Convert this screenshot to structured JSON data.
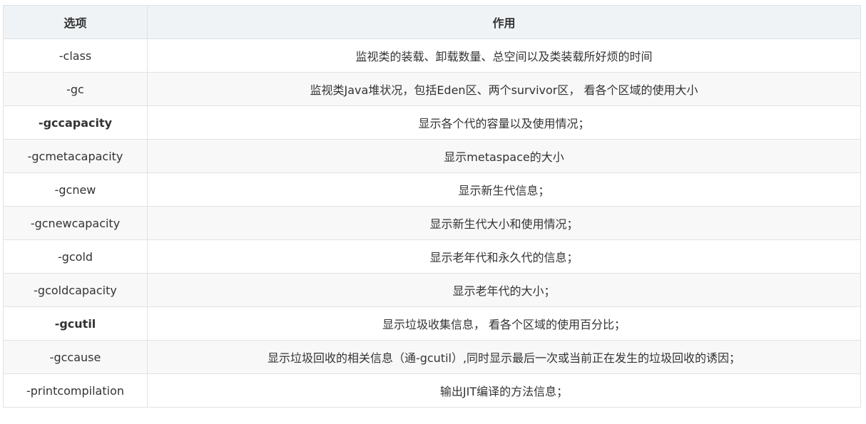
{
  "table": {
    "headers": [
      "选项",
      "作用"
    ],
    "rows": [
      {
        "option": "-class",
        "desc": "监视类的装载、卸载数量、总空间以及类装载所好烦的时间",
        "bold": false
      },
      {
        "option": "-gc",
        "desc": "监视类Java堆状况，包括Eden区、两个survivor区， 看各个区域的使用大小",
        "bold": false
      },
      {
        "option": "-gccapacity",
        "desc": "显示各个代的容量以及使用情况；",
        "bold": true
      },
      {
        "option": "-gcmetacapacity",
        "desc": "显示metaspace的大小",
        "bold": false
      },
      {
        "option": "-gcnew",
        "desc": "显示新生代信息；",
        "bold": false
      },
      {
        "option": "-gcnewcapacity",
        "desc": "显示新生代大小和使用情况；",
        "bold": false
      },
      {
        "option": "-gcold",
        "desc": "显示老年代和永久代的信息；",
        "bold": false
      },
      {
        "option": "-gcoldcapacity",
        "desc": "显示老年代的大小；",
        "bold": false
      },
      {
        "option": "-gcutil",
        "desc": "显示垃圾收集信息， 看各个区域的使用百分比；",
        "bold": true
      },
      {
        "option": "-gccause",
        "desc": "显示垃圾回收的相关信息（通-gcutil）,同时显示最后一次或当前正在发生的垃圾回收的诱因；",
        "bold": false
      },
      {
        "option": "-printcompilation",
        "desc": "输出JIT编译的方法信息；",
        "bold": false
      }
    ]
  }
}
